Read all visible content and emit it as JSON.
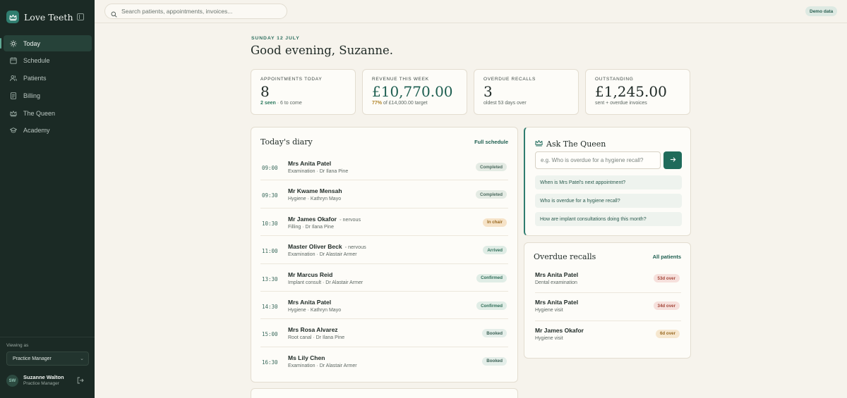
{
  "app": {
    "name": "Love Teeth"
  },
  "sidebar": {
    "items": [
      {
        "label": "Today",
        "icon": "sun-icon",
        "active": true
      },
      {
        "label": "Schedule",
        "icon": "calendar-icon"
      },
      {
        "label": "Patients",
        "icon": "users-icon"
      },
      {
        "label": "Billing",
        "icon": "document-icon"
      },
      {
        "label": "The Queen",
        "icon": "crown-icon"
      },
      {
        "label": "Academy",
        "icon": "graduation-cap-icon"
      }
    ],
    "viewing_label": "Viewing as",
    "role": "Practice Manager",
    "user": {
      "initials": "SW",
      "name": "Suzanne Walton",
      "role": "Practice Manager"
    }
  },
  "topbar": {
    "search_placeholder": "Search patients, appointments, invoices...",
    "demo_badge": "Demo data"
  },
  "header": {
    "date": "SUNDAY 12 JULY",
    "greeting": "Good evening, Suzanne."
  },
  "stats": [
    {
      "label": "APPOINTMENTS TODAY",
      "value": "8",
      "sub_highlight": "2 seen",
      "sub_rest": " · 6 to come"
    },
    {
      "label": "REVENUE THIS WEEK",
      "value": "£10,770.00",
      "sub_highlight": "77%",
      "sub_rest": " of £14,000.00 target"
    },
    {
      "label": "OVERDUE RECALLS",
      "value": "3",
      "sub_highlight": "",
      "sub_rest": "oldest 53 days over"
    },
    {
      "label": "OUTSTANDING",
      "value": "£1,245.00",
      "sub_highlight": "",
      "sub_rest": "sent + overdue invoices"
    }
  ],
  "diary": {
    "title": "Today's diary",
    "link": "Full schedule",
    "appointments": [
      {
        "time": "09:00",
        "name": "Mrs Anita Patel",
        "flag": "",
        "detail": "Examination · Dr Ilana Pine",
        "status": "Completed"
      },
      {
        "time": "09:30",
        "name": "Mr Kwame Mensah",
        "flag": "",
        "detail": "Hygiene · Kathryn Mayo",
        "status": "Completed"
      },
      {
        "time": "10:30",
        "name": "Mr James Okafor",
        "flag": "◦ nervous",
        "detail": "Filling · Dr Ilana Pine",
        "status": "In chair"
      },
      {
        "time": "11:00",
        "name": "Master Oliver Beck",
        "flag": "◦ nervous",
        "detail": "Examination · Dr Alastair Armer",
        "status": "Arrived"
      },
      {
        "time": "13:30",
        "name": "Mr Marcus Reid",
        "flag": "",
        "detail": "Implant consult · Dr Alastair Armer",
        "status": "Confirmed"
      },
      {
        "time": "14:30",
        "name": "Mrs Anita Patel",
        "flag": "",
        "detail": "Hygiene · Kathryn Mayo",
        "status": "Confirmed"
      },
      {
        "time": "15:00",
        "name": "Mrs Rosa Alvarez",
        "flag": "",
        "detail": "Root canal · Dr Ilana Pine",
        "status": "Booked"
      },
      {
        "time": "16:30",
        "name": "Ms Lily Chen",
        "flag": "",
        "detail": "Examination · Dr Alastair Armer",
        "status": "Booked"
      }
    ]
  },
  "queen": {
    "title": "Ask The Queen",
    "input_placeholder": "e.g. Who is overdue for a hygiene recall?",
    "suggestions": [
      "When is Mrs Patel's next appointment?",
      "Who is overdue for a hygiene recall?",
      "How are implant consultations doing this month?"
    ]
  },
  "recalls": {
    "title": "Overdue recalls",
    "link": "All patients",
    "items": [
      {
        "name": "Mrs Anita Patel",
        "type": "Dental examination",
        "over": "53d over",
        "severity": "red"
      },
      {
        "name": "Mrs Anita Patel",
        "type": "Hygiene visit",
        "over": "34d over",
        "severity": "red"
      },
      {
        "name": "Mr James Okafor",
        "type": "Hygiene visit",
        "over": "6d over",
        "severity": "amber"
      }
    ]
  },
  "colors": {
    "sidebar_bg": "#1b2a25",
    "accent": "#1f6b5b",
    "page_bg": "#f6f3ec"
  }
}
